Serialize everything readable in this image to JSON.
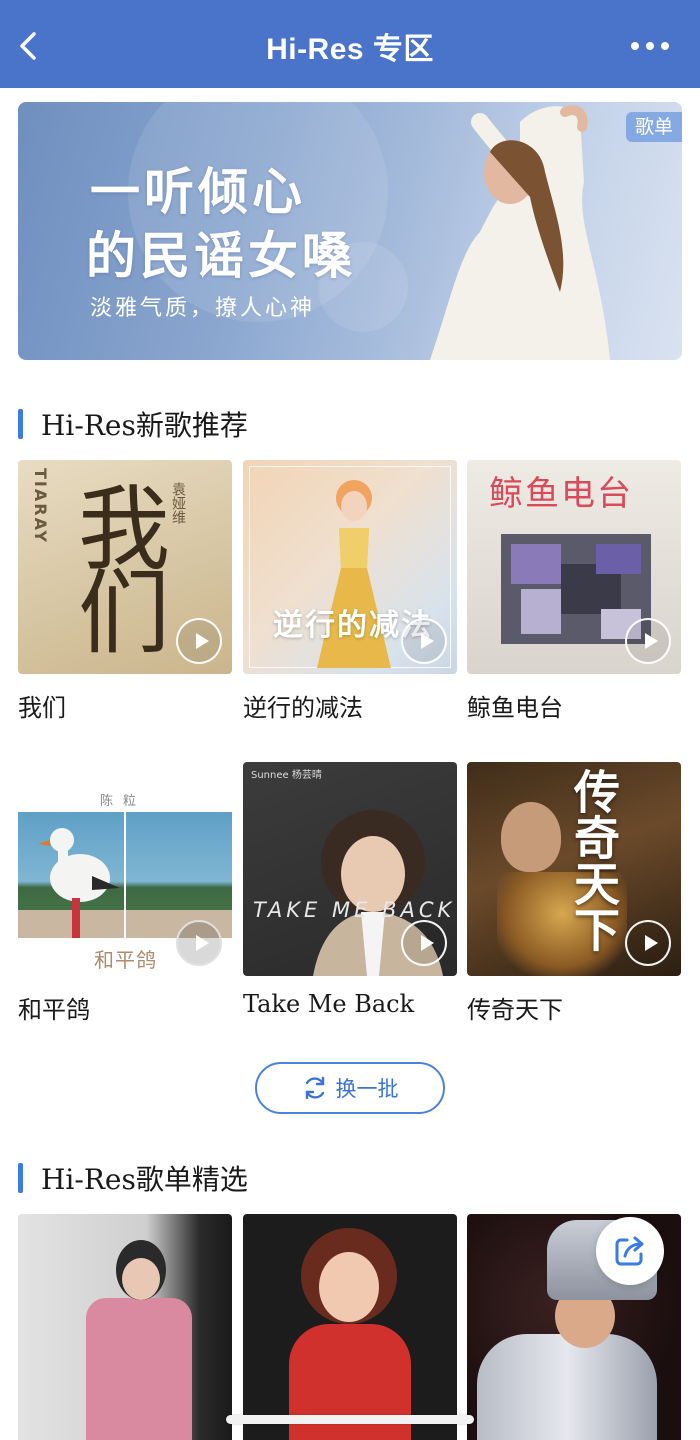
{
  "header": {
    "title": "Hi-Res 专区",
    "back_icon": "chevron-left-icon",
    "more_icon": "more-dots-icon"
  },
  "banner": {
    "line1": "一听倾心",
    "line2": "的民谣女嗓",
    "tagline": "淡雅气质，撩人心神",
    "badge": "歌单"
  },
  "new_songs": {
    "title": "Hi-Res新歌推荐",
    "items": [
      {
        "name": "我们",
        "cover_title": "我们",
        "cover_side": "TIARAY",
        "cover_artist": "袁娅维"
      },
      {
        "name": "逆行的减法",
        "cover_title": "逆行的减法"
      },
      {
        "name": "鲸鱼电台",
        "cover_title": "鲸鱼电台"
      },
      {
        "name": "和平鸽",
        "cover_title": "和平鸽",
        "cover_artist": "陈粒"
      },
      {
        "name": "Take Me Back",
        "cover_title": "TAKE ME BACK",
        "cover_artist": "Sunnee 杨芸晴"
      },
      {
        "name": "传奇天下",
        "cover_title": "传奇天下"
      }
    ]
  },
  "refresh": {
    "label": "换一批",
    "icon": "refresh-icon"
  },
  "playlists": {
    "title": "Hi-Res歌单精选"
  },
  "share": {
    "icon": "share-icon"
  },
  "colors": {
    "header_bg": "#4a74c9",
    "accent": "#3a7be6",
    "refresh_border": "#4a82e0"
  }
}
